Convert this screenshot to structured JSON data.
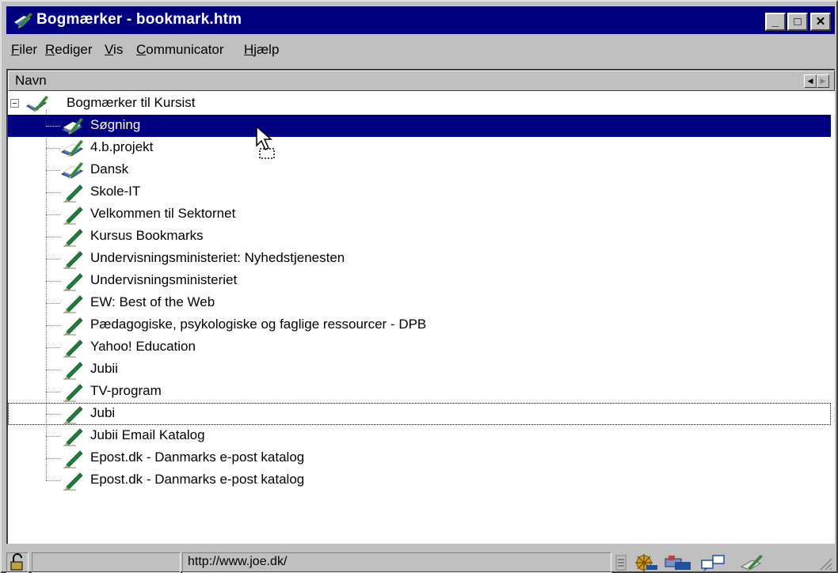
{
  "window": {
    "title": "Bogmærker - bookmark.htm",
    "controls": {
      "minimize": "_",
      "maximize": "□",
      "close": "✕"
    }
  },
  "menu": [
    "Filer",
    "Rediger",
    "Vis",
    "Communicator",
    "Hjælp"
  ],
  "list": {
    "column_header": "Navn",
    "root": "Bogmærker til Kursist",
    "items": [
      {
        "label": "Søgning",
        "type": "folder",
        "selected": true
      },
      {
        "label": "4.b.projekt",
        "type": "folder"
      },
      {
        "label": "Dansk",
        "type": "folder"
      },
      {
        "label": "Skole-IT",
        "type": "bookmark"
      },
      {
        "label": "Velkommen til Sektornet",
        "type": "bookmark"
      },
      {
        "label": "Kursus Bookmarks",
        "type": "bookmark"
      },
      {
        "label": "Undervisningsministeriet: Nyhedstjenesten",
        "type": "bookmark"
      },
      {
        "label": "Undervisningsministeriet",
        "type": "bookmark"
      },
      {
        "label": "EW: Best of the Web",
        "type": "bookmark"
      },
      {
        "label": "Pædagogiske, psykologiske og faglige ressourcer - DPB",
        "type": "bookmark"
      },
      {
        "label": "Yahoo! Education",
        "type": "bookmark"
      },
      {
        "label": "Jubii",
        "type": "bookmark"
      },
      {
        "label": "TV-program",
        "type": "bookmark"
      },
      {
        "label": "Jubi",
        "type": "bookmark",
        "focused": true
      },
      {
        "label": "Jubii Email Katalog",
        "type": "bookmark"
      },
      {
        "label": "Epost.dk - Danmarks e-post katalog",
        "type": "bookmark"
      },
      {
        "label": "Epost.dk - Danmarks e-post katalog",
        "type": "bookmark"
      }
    ]
  },
  "status": {
    "url": "http://www.joe.dk/",
    "icons": [
      "lock-icon",
      "component-bar-icon",
      "navigator-icon",
      "mail-icon",
      "discussions-icon",
      "composer-icon"
    ]
  },
  "colors": {
    "title_bg": "#000080",
    "selection_bg": "#000080",
    "face": "#c0c0c0"
  }
}
